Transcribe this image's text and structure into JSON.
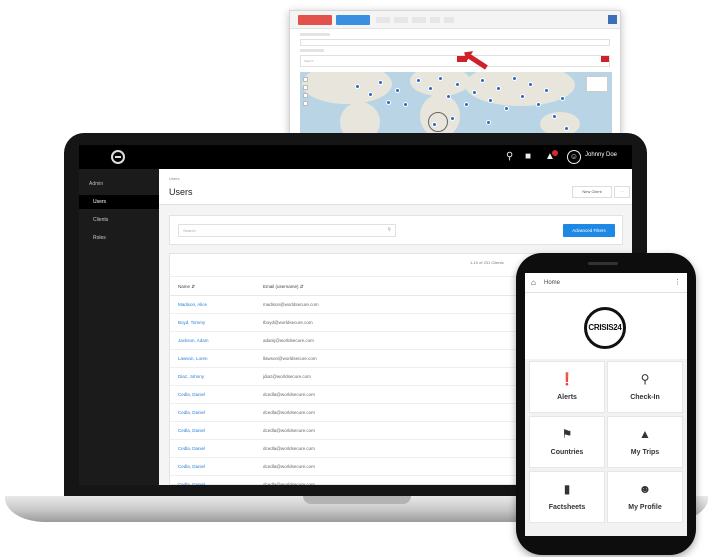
{
  "back_window": {
    "search_label": "Search",
    "pins_count_hint": "",
    "red_button_label": "",
    "blue_button_label": ""
  },
  "laptop": {
    "topbar": {
      "user_name": "Johnny Doe"
    },
    "sidebar": {
      "section_label": "Admin",
      "items": [
        {
          "label": "Users",
          "active": true
        },
        {
          "label": "Clients",
          "active": false
        },
        {
          "label": "Roles",
          "active": false
        }
      ]
    },
    "header": {
      "breadcrumb": "Users",
      "title": "Users",
      "new_button": "New Client",
      "more_button": "···"
    },
    "filters": {
      "search_placeholder": "Search",
      "advanced_button": "Advanced Filters"
    },
    "table": {
      "pager_text": "1-10 of 231 Clients",
      "pager_next": "›",
      "columns": [
        "Name",
        "Email (username)"
      ],
      "rows": [
        {
          "name": "Madison, Alice",
          "email": "madison@worldsecure.com"
        },
        {
          "name": "Boyd, Tommy",
          "email": "tboyd@worldsecure.com"
        },
        {
          "name": "Jackson, Adam",
          "email": "adamj@worldsecure.com"
        },
        {
          "name": "Lawson, Loren",
          "email": "llawson@worldsecure.com"
        },
        {
          "name": "Diaz, Johnny",
          "email": "jdiaz@worldsecure.com"
        },
        {
          "name": "Cedla, Daniel",
          "email": "dcedla@worldsecure.com"
        },
        {
          "name": "Cedla, Daniel",
          "email": "dcedla@worldsecure.com"
        },
        {
          "name": "Cedla, Daniel",
          "email": "dcedla@worldsecure.com"
        },
        {
          "name": "Cedla, Daniel",
          "email": "dcedla@worldsecure.com"
        },
        {
          "name": "Cedla, Daniel",
          "email": "dcedla@worldsecure.com"
        },
        {
          "name": "Cedla, Daniel",
          "email": "dcedla@worldsecure.com"
        }
      ]
    }
  },
  "phone": {
    "title": "Home",
    "logo_text": "CRISIS24",
    "tiles": [
      {
        "label": "Alerts",
        "icon": "alert-icon"
      },
      {
        "label": "Check-In",
        "icon": "location-pin-icon"
      },
      {
        "label": "Countries",
        "icon": "flag-icon"
      },
      {
        "label": "My Trips",
        "icon": "road-icon"
      },
      {
        "label": "Factsheets",
        "icon": "book-icon"
      },
      {
        "label": "My Profile",
        "icon": "user-icon"
      }
    ]
  },
  "colors": {
    "accent_blue": "#1e88e5",
    "link_blue": "#2a7fd6",
    "alert_red": "#d0202a",
    "map_water": "#b9d4e4"
  }
}
